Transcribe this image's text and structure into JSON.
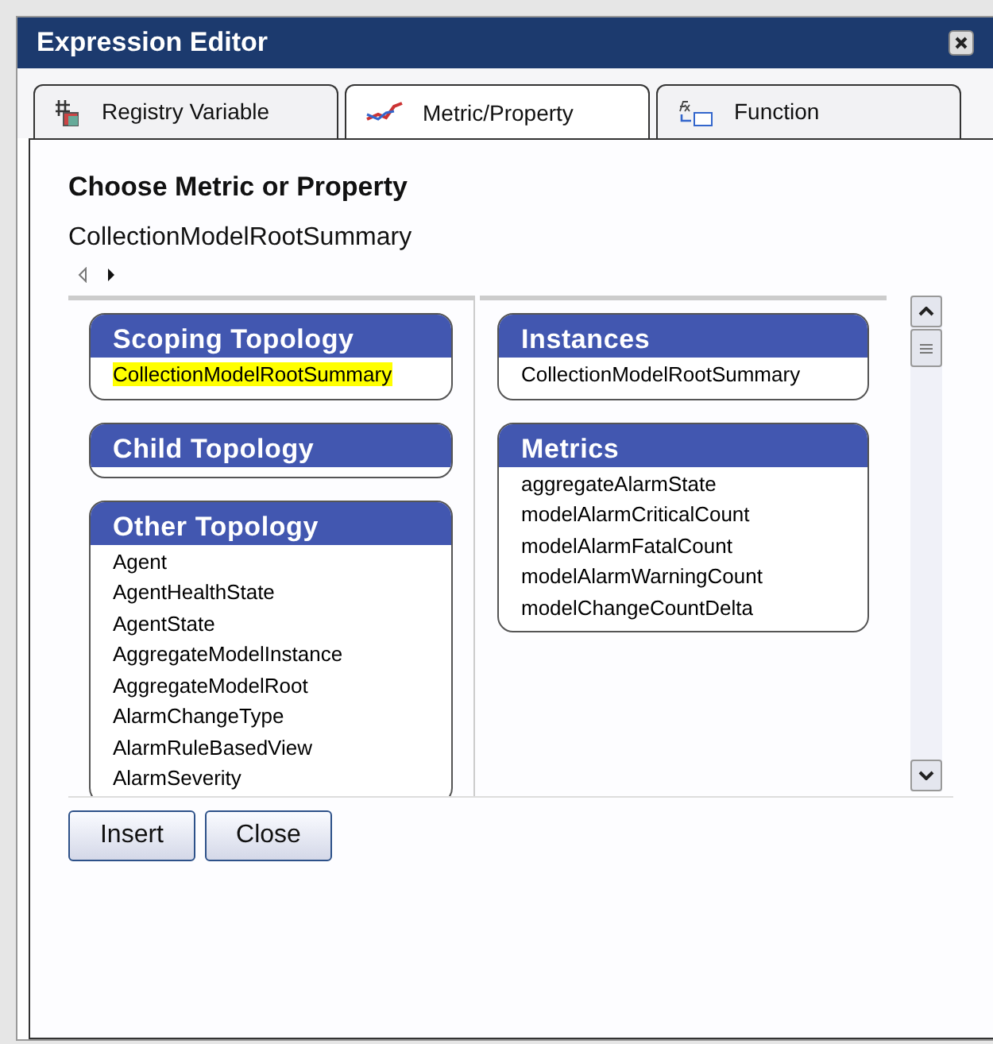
{
  "window": {
    "title": "Expression Editor"
  },
  "tabs": [
    {
      "label": "Registry Variable",
      "kind": "registry",
      "selected": false
    },
    {
      "label": "Metric/Property",
      "kind": "metric",
      "selected": true
    },
    {
      "label": "Function",
      "kind": "function",
      "selected": false
    }
  ],
  "heading": "Choose Metric or Property",
  "path": "CollectionModelRootSummary",
  "left_groups": [
    {
      "title": "Scoping Topology",
      "items": [
        {
          "label": "CollectionModelRootSummary",
          "selected": true
        }
      ]
    },
    {
      "title": "Child Topology"
    },
    {
      "title": "Other Topology",
      "items": [
        {
          "label": "Agent",
          "selected": false
        },
        {
          "label": "AgentHealthState",
          "selected": false
        },
        {
          "label": "AgentState",
          "selected": false
        },
        {
          "label": "AggregateModelInstance",
          "selected": false
        },
        {
          "label": "AggregateModelRoot",
          "selected": false
        },
        {
          "label": "AlarmChangeType",
          "selected": false
        },
        {
          "label": "AlarmRuleBasedView",
          "selected": false
        },
        {
          "label": "AlarmSeverity",
          "selected": false
        }
      ]
    }
  ],
  "right_groups": [
    {
      "title": "Instances",
      "items": [
        {
          "label": "CollectionModelRootSummary",
          "selected": false
        }
      ]
    },
    {
      "title": "Metrics",
      "items": [
        {
          "label": "aggregateAlarmState",
          "selected": false
        },
        {
          "label": "modelAlarmCriticalCount",
          "selected": false
        },
        {
          "label": "modelAlarmFatalCount",
          "selected": false
        },
        {
          "label": "modelAlarmWarningCount",
          "selected": false
        },
        {
          "label": "modelChangeCountDelta",
          "selected": false
        }
      ]
    }
  ],
  "buttons": [
    "Insert",
    "Close"
  ]
}
